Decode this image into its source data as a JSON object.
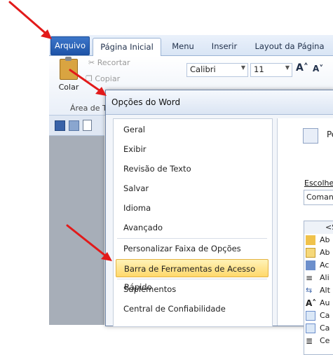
{
  "ribbon": {
    "tabs": [
      "Arquivo",
      "Página Inicial",
      "Menu",
      "Inserir",
      "Layout da Página"
    ],
    "paste_label": "Colar",
    "cut_label": "Recortar",
    "copy_label": "Copiar",
    "font_name": "Calibri",
    "font_size": "11",
    "group_label": "Área de T"
  },
  "dialog": {
    "title": "Opções do Word",
    "nav_items": [
      "Geral",
      "Exibir",
      "Revisão de Texto",
      "Salvar",
      "Idioma",
      "Avançado",
      "Personalizar Faixa de Opções",
      "Barra de Ferramentas de Acesso Rápido",
      "Suplementos",
      "Central de Confiabilidade"
    ],
    "selected_index": 7,
    "right": {
      "header_partial": "Pe",
      "choose_label": "Escolher",
      "choose_value": "Comand",
      "list_header": "<S",
      "commands": [
        "Ab",
        "Ab",
        "Ac",
        "Ali",
        "Alt",
        "Au",
        "Ca",
        "Ca",
        "Ce"
      ]
    }
  },
  "colors": {
    "file_tab": "#2a62b8",
    "selected_item": "#ffd86b",
    "arrow": "#e21a1a"
  }
}
